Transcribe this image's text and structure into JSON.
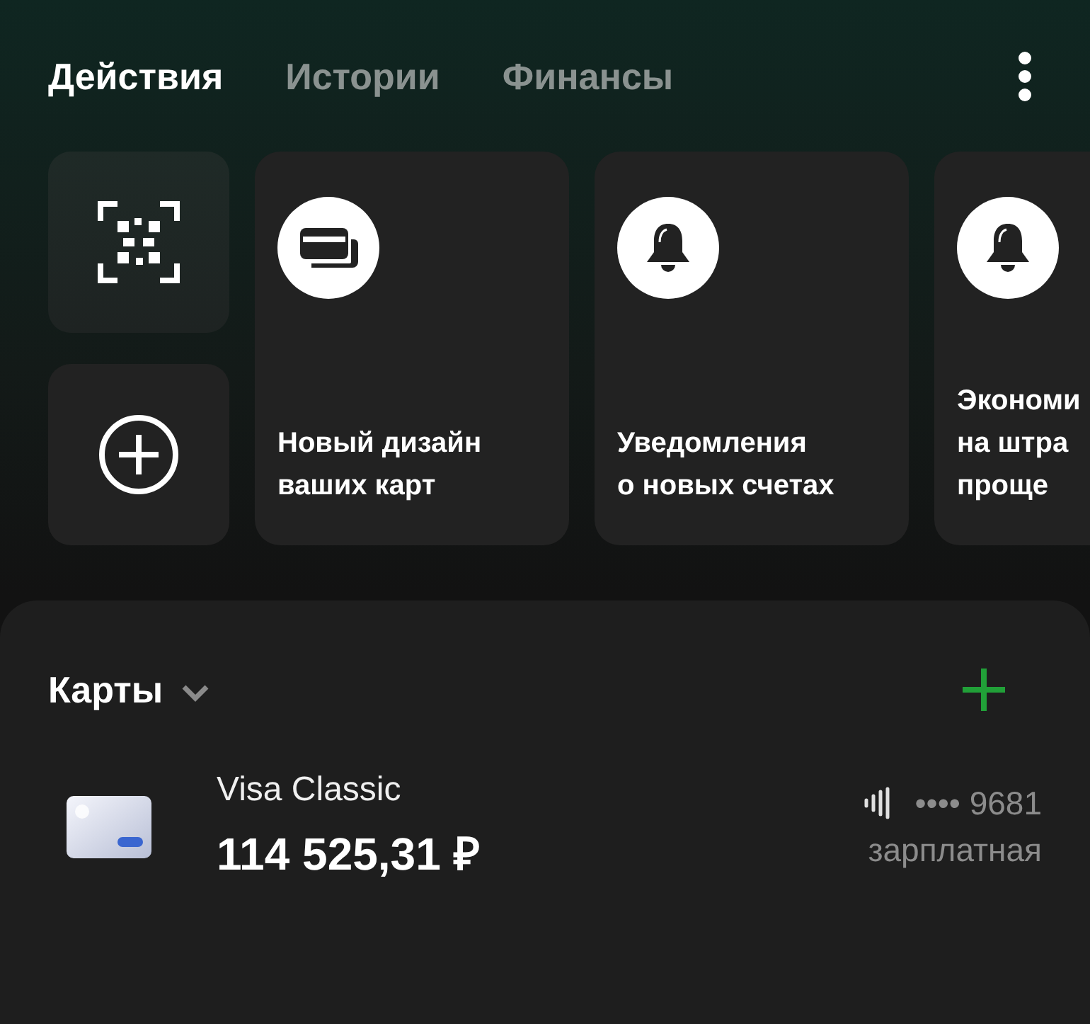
{
  "tabs": [
    {
      "label": "Действия",
      "selected": true
    },
    {
      "label": "Истории",
      "selected": false
    },
    {
      "label": "Финансы",
      "selected": false
    }
  ],
  "quick_actions": [
    {
      "kind": "scan"
    },
    {
      "kind": "add"
    }
  ],
  "stories": [
    {
      "kind": "card",
      "lines": [
        "Новый дизайн",
        "ваших карт"
      ]
    },
    {
      "kind": "bell",
      "lines": [
        "Уведомления",
        "о новых счетах"
      ]
    },
    {
      "kind": "bell",
      "lines": [
        "Экономи",
        "на штра",
        "проще"
      ]
    }
  ],
  "cards_section": {
    "title": "Карты",
    "expanded": false,
    "cards": [
      {
        "name": "Visa Classic",
        "balance": "114 525,31 ₽",
        "contactless": true,
        "number": "•••• 9681",
        "label": "зарплатная"
      }
    ]
  }
}
